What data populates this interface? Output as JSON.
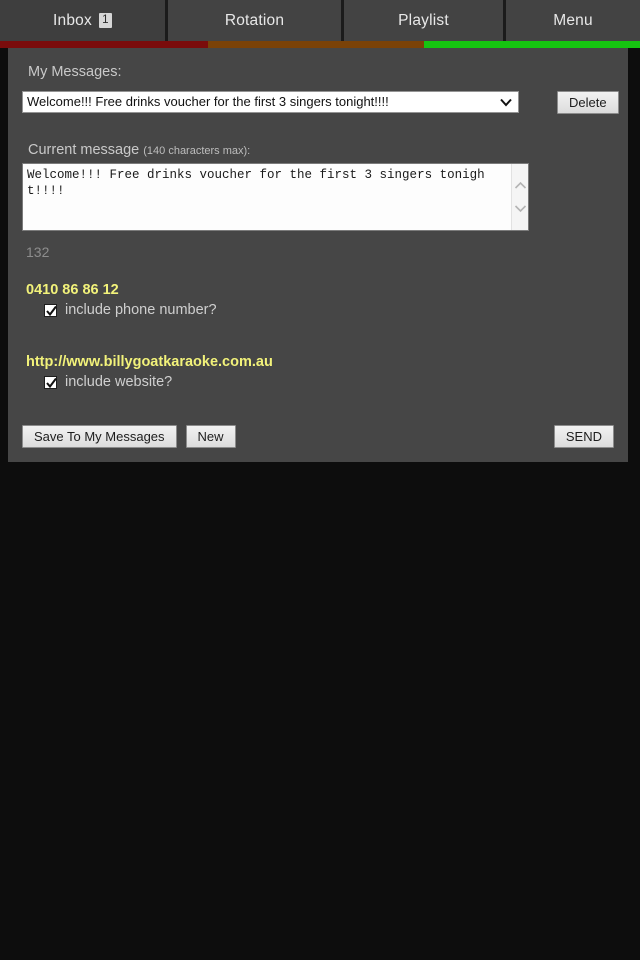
{
  "tabs": [
    {
      "label": "Inbox",
      "badge": "1",
      "accent": "#7a0c0c",
      "active": true
    },
    {
      "label": "Rotation",
      "badge": "",
      "accent": "#7a4208",
      "active": false
    },
    {
      "label": "Playlist",
      "badge": "",
      "accent": "#16c411",
      "active": false
    },
    {
      "label": "Menu",
      "badge": "",
      "accent": "",
      "active": false
    }
  ],
  "accent_strip": [
    {
      "color": "#7a0c0c"
    },
    {
      "color": "#7a4208"
    },
    {
      "color": "#16c411"
    }
  ],
  "panel": {
    "my_messages_label": "My Messages:",
    "selected_message": "Welcome!!! Free drinks voucher for the first 3 singers tonight!!!!",
    "delete_label": "Delete",
    "current_message_label": "Current message",
    "current_message_hint": "(140 characters max):",
    "message_text": "Welcome!!! Free drinks voucher for the first 3 singers tonight!!!!",
    "character_counter": "132",
    "phone_number": "0410 86 86 12",
    "include_phone_label": "include phone number?",
    "include_phone_checked": true,
    "website": "http://www.billygoatkaraoke.com.au",
    "include_website_label": "include website?",
    "include_website_checked": true,
    "save_label": "Save To My Messages",
    "new_label": "New",
    "send_label": "SEND"
  },
  "colors": {
    "page_background": "#0d0d0d",
    "panel_background": "#464646",
    "tabbar_background": "#434343",
    "accent_yellow": "#f2f27a",
    "accent_red": "#7a0c0c",
    "accent_brown": "#7a4208",
    "accent_green": "#16c411"
  }
}
